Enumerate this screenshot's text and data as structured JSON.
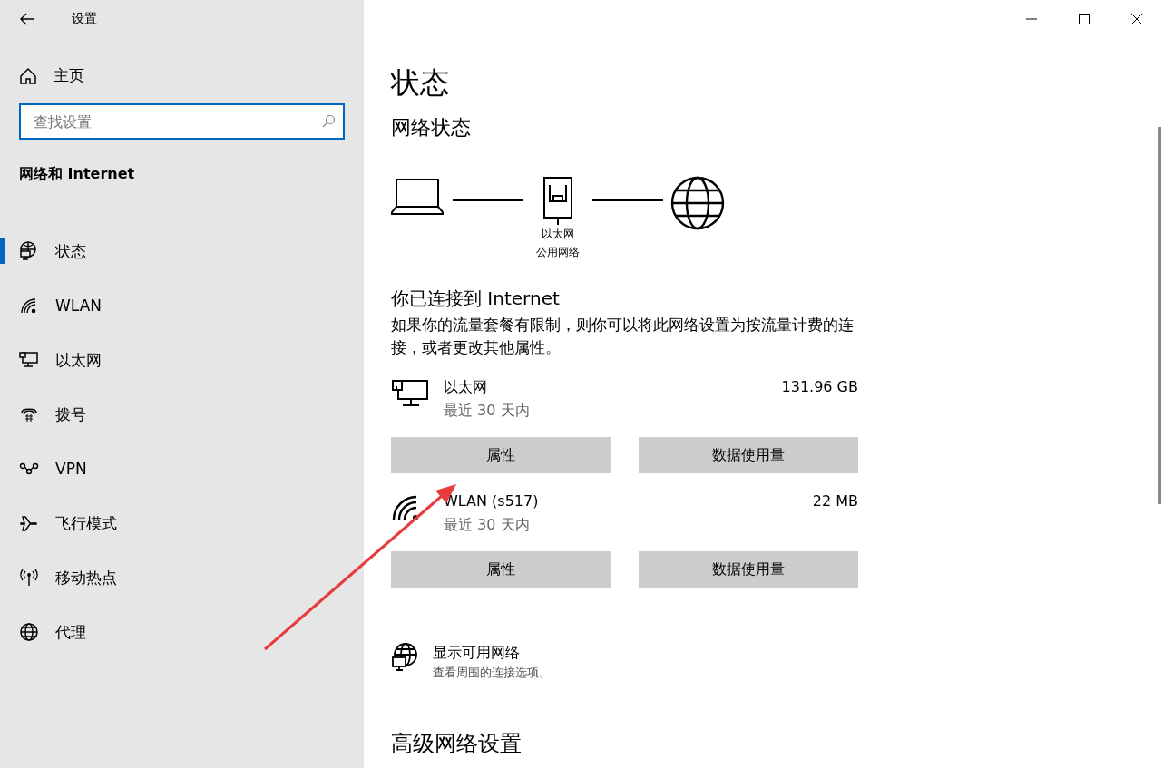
{
  "window": {
    "title": "设置"
  },
  "sidebar": {
    "home": "主页",
    "search": {
      "placeholder": "查找设置"
    },
    "section": "网络和 Internet",
    "items": [
      {
        "label": "状态",
        "kind": "status",
        "selected": true
      },
      {
        "label": "WLAN",
        "kind": "wifi",
        "selected": false
      },
      {
        "label": "以太网",
        "kind": "ethernet",
        "selected": false
      },
      {
        "label": "拨号",
        "kind": "dialup",
        "selected": false
      },
      {
        "label": "VPN",
        "kind": "vpn",
        "selected": false
      },
      {
        "label": "飞行模式",
        "kind": "airplane",
        "selected": false
      },
      {
        "label": "移动热点",
        "kind": "hotspot",
        "selected": false
      },
      {
        "label": "代理",
        "kind": "globe",
        "selected": false
      }
    ]
  },
  "main": {
    "title": "状态",
    "network_status": {
      "heading": "网络状态",
      "adapter": "以太网",
      "profile": "公用网络"
    },
    "connected": "你已连接到 Internet",
    "description": "如果你的流量套餐有限制，则你可以将此网络设置为按流量计费的连接，或者更改其他属性。",
    "connections": [
      {
        "kind": "ethernet",
        "name": "以太网",
        "period": "最近 30 天内",
        "usage": "131.96 GB",
        "buttons": [
          "属性",
          "数据使用量"
        ]
      },
      {
        "kind": "wifi",
        "name": "WLAN (s517)",
        "period": "最近 30 天内",
        "usage": "22 MB",
        "buttons": [
          "属性",
          "数据使用量"
        ]
      }
    ],
    "show_networks": {
      "title": "显示可用网络",
      "subtitle": "查看周围的连接选项。"
    },
    "advanced_heading": "高级网络设置"
  }
}
